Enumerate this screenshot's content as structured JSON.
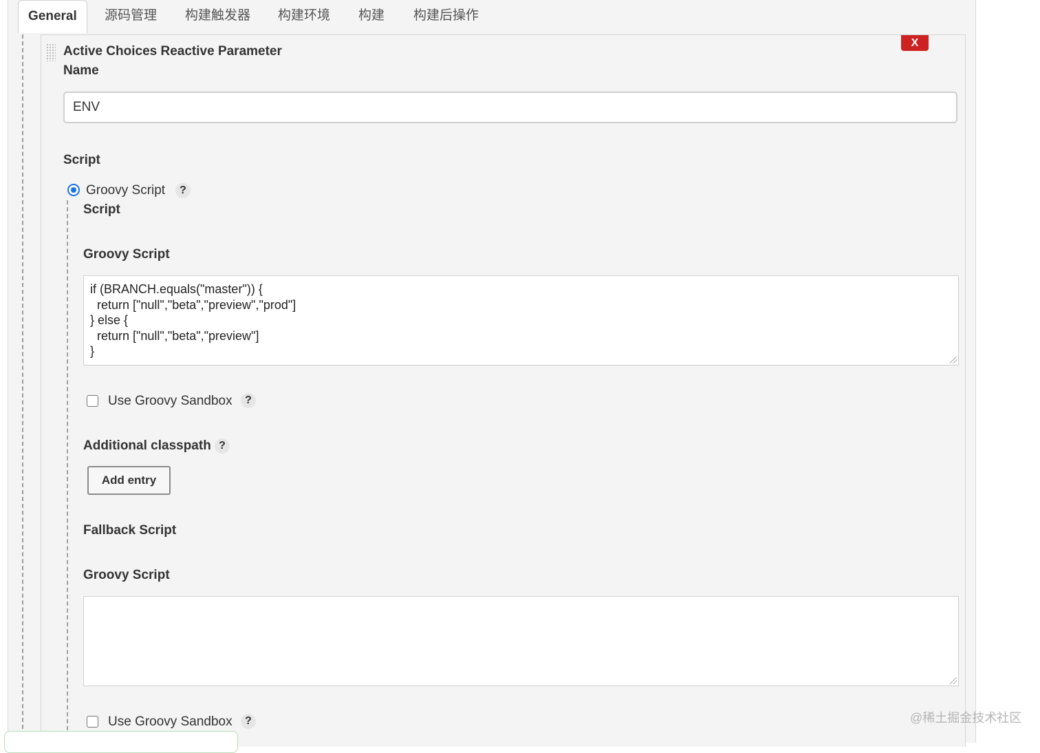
{
  "tabs": [
    {
      "label": "General",
      "active": true
    },
    {
      "label": "源码管理"
    },
    {
      "label": "构建触发器"
    },
    {
      "label": "构建环境"
    },
    {
      "label": "构建"
    },
    {
      "label": "构建后操作"
    }
  ],
  "parameter": {
    "title": "Active Choices Reactive Parameter",
    "delete_label": "X",
    "name_label": "Name",
    "name_value": "ENV",
    "script_label": "Script",
    "radio_option": "Groovy Script",
    "help_label": "?",
    "sub_script_label": "Script",
    "groovy_script_label": "Groovy Script",
    "groovy_script_code": "if (BRANCH.equals(\"master\")) {\n  return [\"null\",\"beta\",\"preview\",\"prod\"]\n} else {\n  return [\"null\",\"beta\",\"preview\"]\n}",
    "sandbox_label": "Use Groovy Sandbox",
    "sandbox_checked": false,
    "classpath_label": "Additional classpath",
    "add_entry_label": "Add entry",
    "fallback_label": "Fallback Script",
    "fallback_groovy_label": "Groovy Script",
    "fallback_code": "",
    "fallback_sandbox_label": "Use Groovy Sandbox",
    "fallback_sandbox_checked": false
  },
  "watermark": "@稀土掘金技术社区",
  "colors": {
    "accent": "#1a73e8",
    "danger": "#cc2222",
    "panel": "#f4f4f4"
  }
}
